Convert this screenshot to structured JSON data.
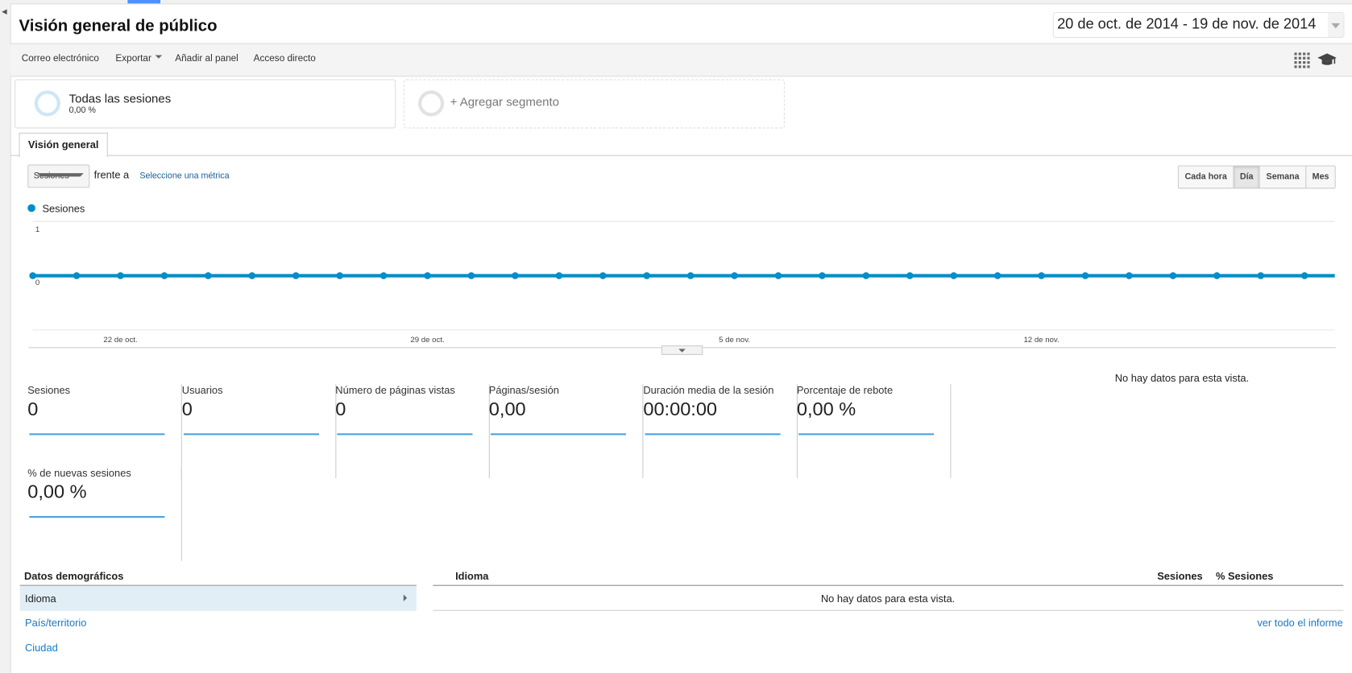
{
  "header": {
    "title": "Visión general de público",
    "date_range": "20 de oct. de 2014 - 19 de nov. de 2014"
  },
  "toolbar": {
    "items": [
      "Correo electrónico",
      "Exportar",
      "Añadir al panel",
      "Acceso directo"
    ],
    "icons": [
      "grid-icon",
      "graduation-cap-icon"
    ]
  },
  "segments": [
    {
      "label": "Todas las sesiones",
      "value": "0,00 %"
    },
    {
      "label": "+ Agregar segmento"
    }
  ],
  "tabs": [
    {
      "label": "Visión general"
    }
  ],
  "chart_controls": {
    "metric": "Sesiones",
    "versus": "frente a",
    "select_metric": "Seleccione una métrica",
    "granularity": [
      "Cada hora",
      "Día",
      "Semana",
      "Mes"
    ],
    "selected": "Día"
  },
  "chart_data": {
    "type": "line",
    "legend": [
      "Sesiones"
    ],
    "series": [
      {
        "name": "Sesiones",
        "color": "#058dc7",
        "values": [
          0,
          0,
          0,
          0,
          0,
          0,
          0,
          0,
          0,
          0,
          0,
          0,
          0,
          0,
          0,
          0,
          0,
          0,
          0,
          0,
          0,
          0,
          0,
          0,
          0,
          0,
          0,
          0,
          0,
          0,
          0
        ]
      }
    ],
    "x_start": "20 de oct. de 2014",
    "x_end": "19 de nov. de 2014",
    "x_ticks": [
      {
        "index": 2,
        "label": "22 de oct."
      },
      {
        "index": 9,
        "label": "29 de oct."
      },
      {
        "index": 16,
        "label": "5 de nov."
      },
      {
        "index": 23,
        "label": "12 de nov."
      }
    ],
    "y_ticks": [
      "1",
      "0"
    ],
    "ylim": [
      0,
      1
    ],
    "grid": true
  },
  "metrics": [
    {
      "label": "Sesiones",
      "value": "0"
    },
    {
      "label": "Usuarios",
      "value": "0"
    },
    {
      "label": "Número de páginas vistas",
      "value": "0"
    },
    {
      "label": "Páginas/sesión",
      "value": "0,00"
    },
    {
      "label": "Duración media de la sesión",
      "value": "00:00:00"
    },
    {
      "label": "Porcentaje de rebote",
      "value": "0,00 %"
    },
    {
      "label": "% de nuevas sesiones",
      "value": "0,00 %"
    }
  ],
  "pie_nodata": "No hay datos para esta vista.",
  "demographics": {
    "title": "Datos demográficos",
    "items": [
      "Idioma",
      "País/territorio",
      "Ciudad"
    ],
    "selected": "Idioma"
  },
  "table": {
    "columns": [
      "Idioma",
      "Sesiones",
      "% Sesiones"
    ],
    "empty": "No hay datos para esta vista.",
    "view_full": "ver todo el informe"
  }
}
